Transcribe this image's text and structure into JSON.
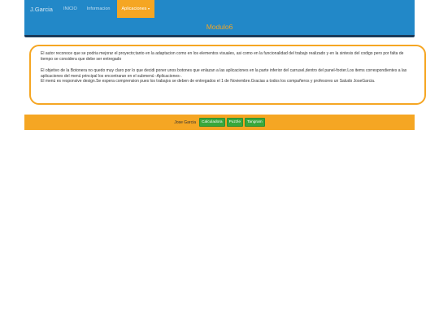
{
  "navbar": {
    "brand": "J.Garcia",
    "links": [
      "INICIO",
      "Informacion"
    ],
    "dropdown_label": "Aplicaciones"
  },
  "header": {
    "title": "Modulo6"
  },
  "info": {
    "paragraph1": "El autor reconoce que se podria mejorar el proyecto;tanto en la adaptacion como en los elementos visuales, asi como en la funcionalidad del trabajo realizado y en la sintesis del codigo pero por falta de tiempo se considera que debe ser entregado",
    "paragraph2": "El objetivo de la Botonera no quedo muy claro por lo que decidi poner unos botones que enlazan a las aplicaciones en la parte inferior del carrusel,dentro del panel-footer.Los items correspondientes a las aplicaciones del menú principal los encontraran en el submenú -Aplicaciones-.",
    "paragraph3": "El menú es responsive design.Se espera comprension pues los trabajos se deben de entregados el 1 de Noviembre.Gracias a todos los compañeros y profesores un Saludo JoseGarcia."
  },
  "footer": {
    "author": "Jose Garcia",
    "buttons": [
      "Calculadora",
      "Puzzle",
      "Tangram"
    ]
  },
  "colors": {
    "primary": "#2288c8",
    "accent": "#f5a623",
    "button": "#38a83c"
  }
}
